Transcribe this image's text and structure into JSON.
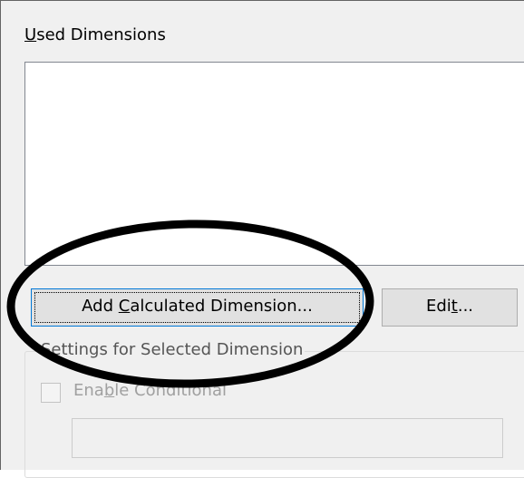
{
  "used_dimensions": {
    "label_mnemonic": "U",
    "label_rest": "sed Dimensions"
  },
  "buttons": {
    "add_calculated": {
      "pre": "Add ",
      "mnemonic": "C",
      "post": "alculated Dimension..."
    },
    "edit": {
      "pre": "Edi",
      "mnemonic": "t",
      "post": "..."
    }
  },
  "settings": {
    "title": "Settings for Selected Dimension",
    "enable_conditional": {
      "pre": "Ena",
      "mnemonic": "b",
      "post": "le Conditional",
      "checked": false,
      "enabled": false
    },
    "condition_value": ""
  },
  "annotation": {
    "shape": "ellipse",
    "color": "#000000"
  }
}
